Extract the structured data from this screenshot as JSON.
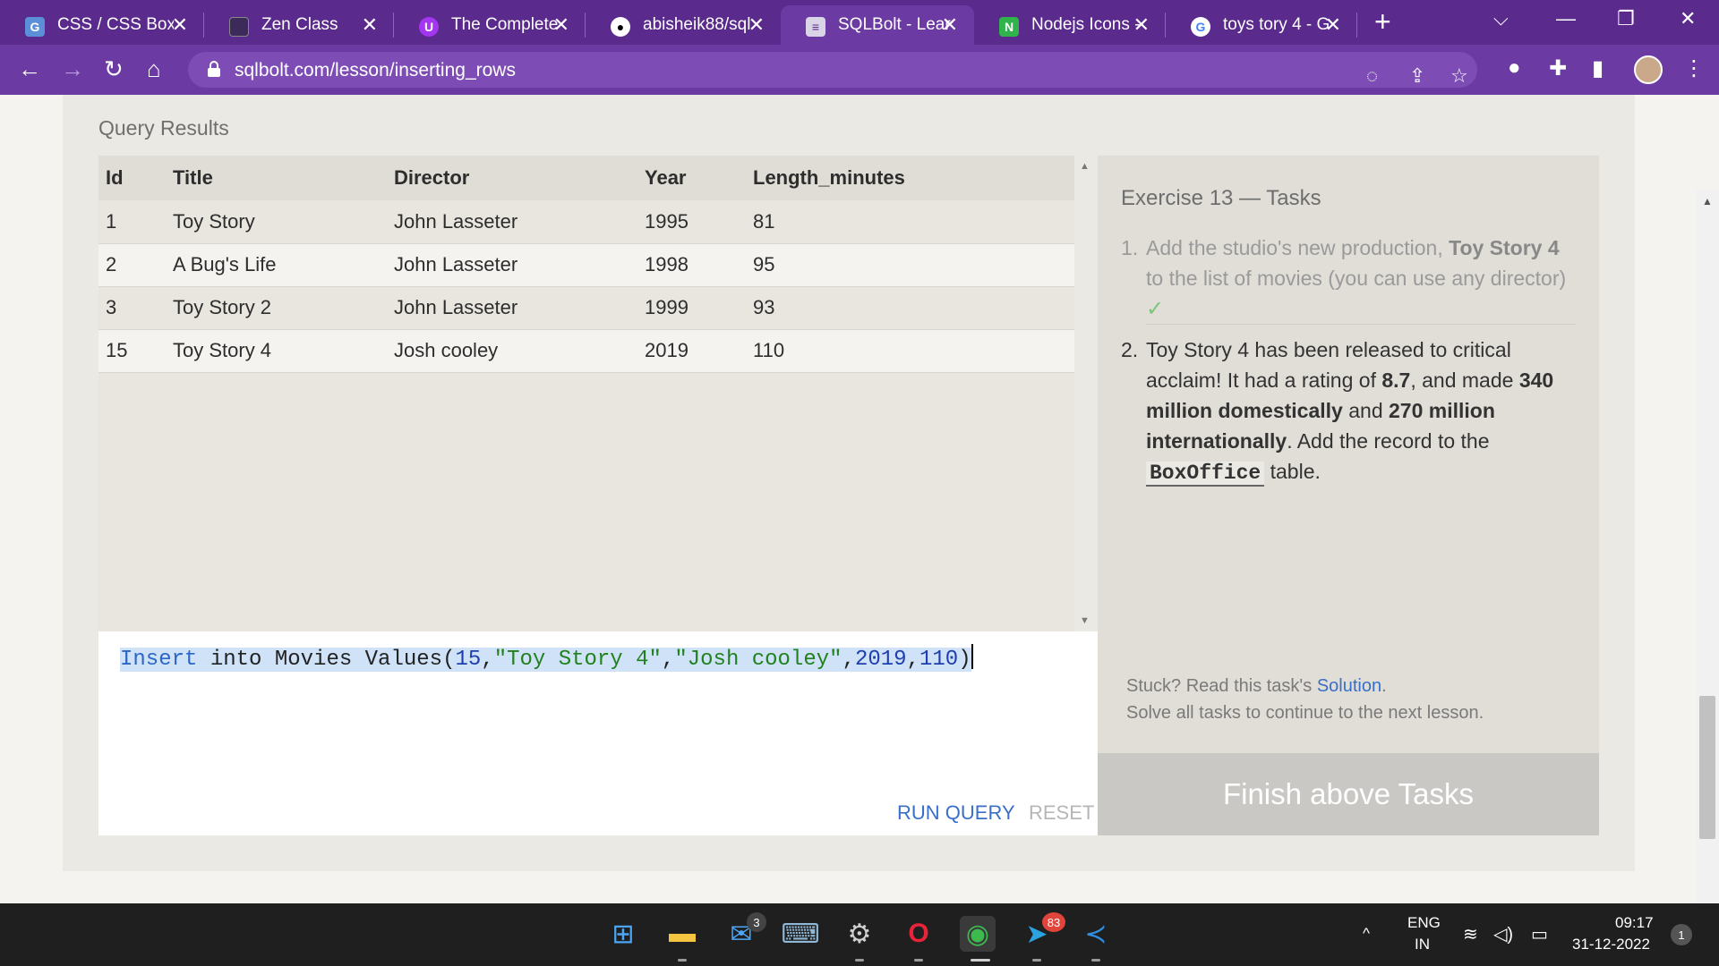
{
  "browser": {
    "tabs": [
      {
        "title": "CSS / CSS Box",
        "icon": "generic-page-icon",
        "active": false
      },
      {
        "title": "Zen Class",
        "icon": "zen-class-icon",
        "active": false
      },
      {
        "title": "The Complete",
        "icon": "udemy-icon",
        "active": false
      },
      {
        "title": "abisheik88/sql",
        "icon": "github-icon",
        "active": false
      },
      {
        "title": "SQLBolt - Lear",
        "icon": "sqlbolt-icon",
        "active": true
      },
      {
        "title": "Nodejs Icons -",
        "icon": "nodejs-icons-icon",
        "active": false
      },
      {
        "title": "toys tory 4 - G",
        "icon": "google-icon",
        "active": false
      }
    ],
    "url": "sqlbolt.com/lesson/inserting_rows"
  },
  "query_results": {
    "title": "Query Results",
    "columns": [
      "Id",
      "Title",
      "Director",
      "Year",
      "Length_minutes"
    ],
    "rows": [
      [
        "1",
        "Toy Story",
        "John Lasseter",
        "1995",
        "81"
      ],
      [
        "2",
        "A Bug's Life",
        "John Lasseter",
        "1998",
        "95"
      ],
      [
        "3",
        "Toy Story 2",
        "John Lasseter",
        "1999",
        "93"
      ],
      [
        "15",
        "Toy Story 4",
        "Josh cooley",
        "2019",
        "110"
      ]
    ]
  },
  "editor": {
    "query": "Insert into Movies Values(15,\"Toy Story 4\",\"Josh cooley\",2019,110)",
    "tokens": {
      "kw1": "Insert",
      "t1": " into Movies Values(",
      "n1": "15",
      "c1": ",",
      "s1": "\"Toy Story 4\"",
      "c2": ",",
      "s2": "\"Josh cooley\"",
      "c3": ",",
      "n2": "2019",
      "c4": ",",
      "n3": "110",
      "p": ")"
    },
    "run_label": "RUN QUERY",
    "reset_label": "RESET"
  },
  "tasks": {
    "title": "Exercise 13 — Tasks",
    "task1": {
      "num": "1.",
      "pre": "Add the studio's new production, ",
      "bold": "Toy Story 4",
      "post": " to the list of movies (you can use any director)",
      "check": "✓"
    },
    "task2": {
      "num": "2.",
      "p1": "Toy Story 4 has been released to critical acclaim! It had a rating of ",
      "b1": "8.7",
      "p2": ", and made ",
      "b2": "340 million domestically",
      "p3": " and ",
      "b3": "270 million internationally",
      "p4": ". Add the record to the ",
      "code": "BoxOffice",
      "p5": " table."
    },
    "help_pre": "Stuck? Read this task's ",
    "help_link": "Solution",
    "help_post": ".",
    "help_line2": "Solve all tasks to continue to the next lesson.",
    "finish_label": "Finish above Tasks"
  },
  "taskbar": {
    "mail_badge": "3",
    "telegram_badge": "83",
    "lang1": "ENG",
    "lang2": "IN",
    "time": "09:17",
    "date": "31-12-2022",
    "notifications": "1"
  },
  "colors": {
    "tab_bar": "#5a2a8c",
    "toolbar": "#6b3ba3",
    "link_blue": "#3a6fc9",
    "finish_button": "#c9c8c4"
  }
}
